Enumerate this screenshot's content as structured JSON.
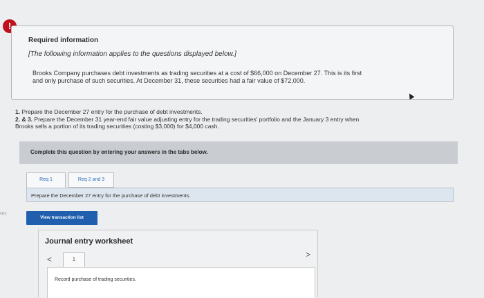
{
  "alert": {
    "icon": "!"
  },
  "info": {
    "title": "Required information",
    "subtitle": "[The following information applies to the questions displayed below.]",
    "body_line1": "Brooks Company purchases debt investments as trading securities at a cost of $66,000 on December 27. This is its first",
    "body_line2": "and only purchase of such securities. At December 31, these securities had a fair value of $72,000."
  },
  "questions": {
    "q1": "1. Prepare the December 27 entry for the purchase of debt investments.",
    "q2_line1": "2. & 3. Prepare the December 31 year-end fair value adjusting entry for the trading securities' portfolio and the January 3 entry when",
    "q2_line2": "Brooks sells a portion of its trading securities (costing $3,000) for $4,000 cash."
  },
  "instruction": "Complete this question by entering your answers in the tabs below.",
  "side_text": "ces",
  "tabs": [
    {
      "label": "Req 1",
      "active": true
    },
    {
      "label": "Req 2 and 3",
      "active": false
    }
  ],
  "prompt": "Prepare the December 27 entry for the purchase of debt investments.",
  "view_button": "View transaction list",
  "worksheet": {
    "title": "Journal entry worksheet",
    "prev_icon": "<",
    "next_icon": ">",
    "page": "1",
    "description": "Record purchase of trading securities."
  },
  "colors": {
    "alert": "#c0101c",
    "button": "#1f5fae",
    "tab_link": "#2a6ab8"
  }
}
